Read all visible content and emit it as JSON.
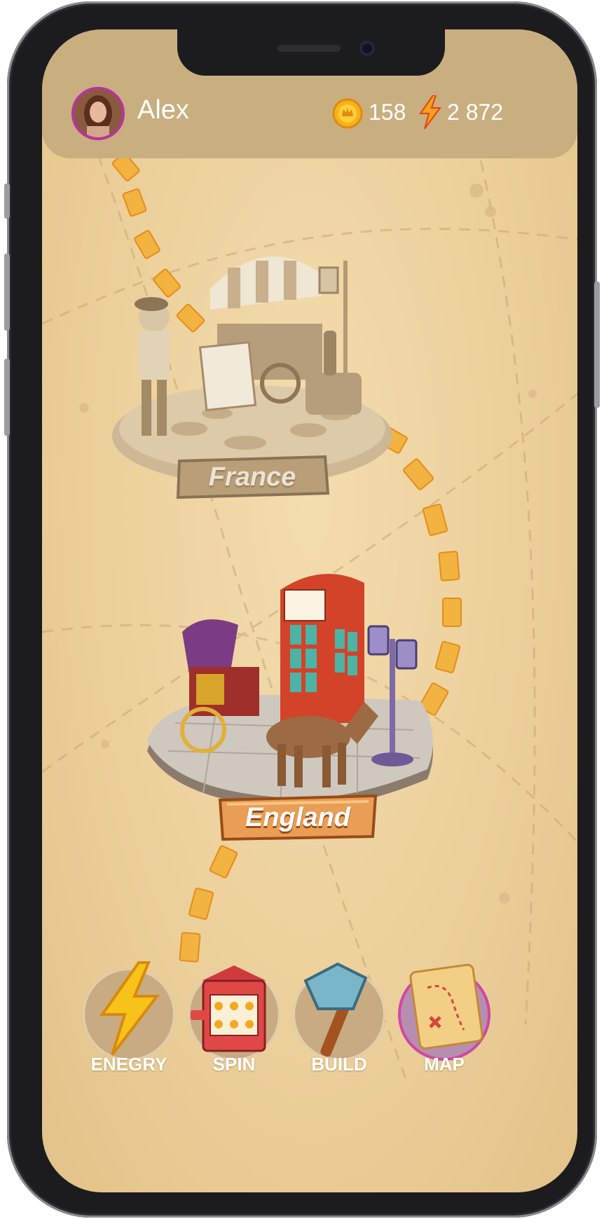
{
  "header": {
    "player_name": "Alex",
    "avatar_icon": "player-avatar",
    "coins": "158",
    "coin_icon": "coin-icon",
    "energy": "2 872",
    "energy_icon": "lightning-bolt-icon"
  },
  "map": {
    "locations": [
      {
        "name": "France",
        "state": "locked"
      },
      {
        "name": "England",
        "state": "unlocked"
      }
    ]
  },
  "nav": {
    "items": [
      {
        "label": "ENEGRY",
        "icon": "lightning-bolt-icon"
      },
      {
        "label": "SPIN",
        "icon": "slot-machine-icon"
      },
      {
        "label": "BUILD",
        "icon": "hammer-icon"
      },
      {
        "label": "MAP",
        "icon": "treasure-map-icon",
        "active": true
      }
    ]
  },
  "colors": {
    "map_background": "#ecd09b",
    "header": "#c9ae80",
    "path": "#f2b340",
    "map_active_ring": "#d247a2",
    "avatar_ring": "#b6359a"
  }
}
